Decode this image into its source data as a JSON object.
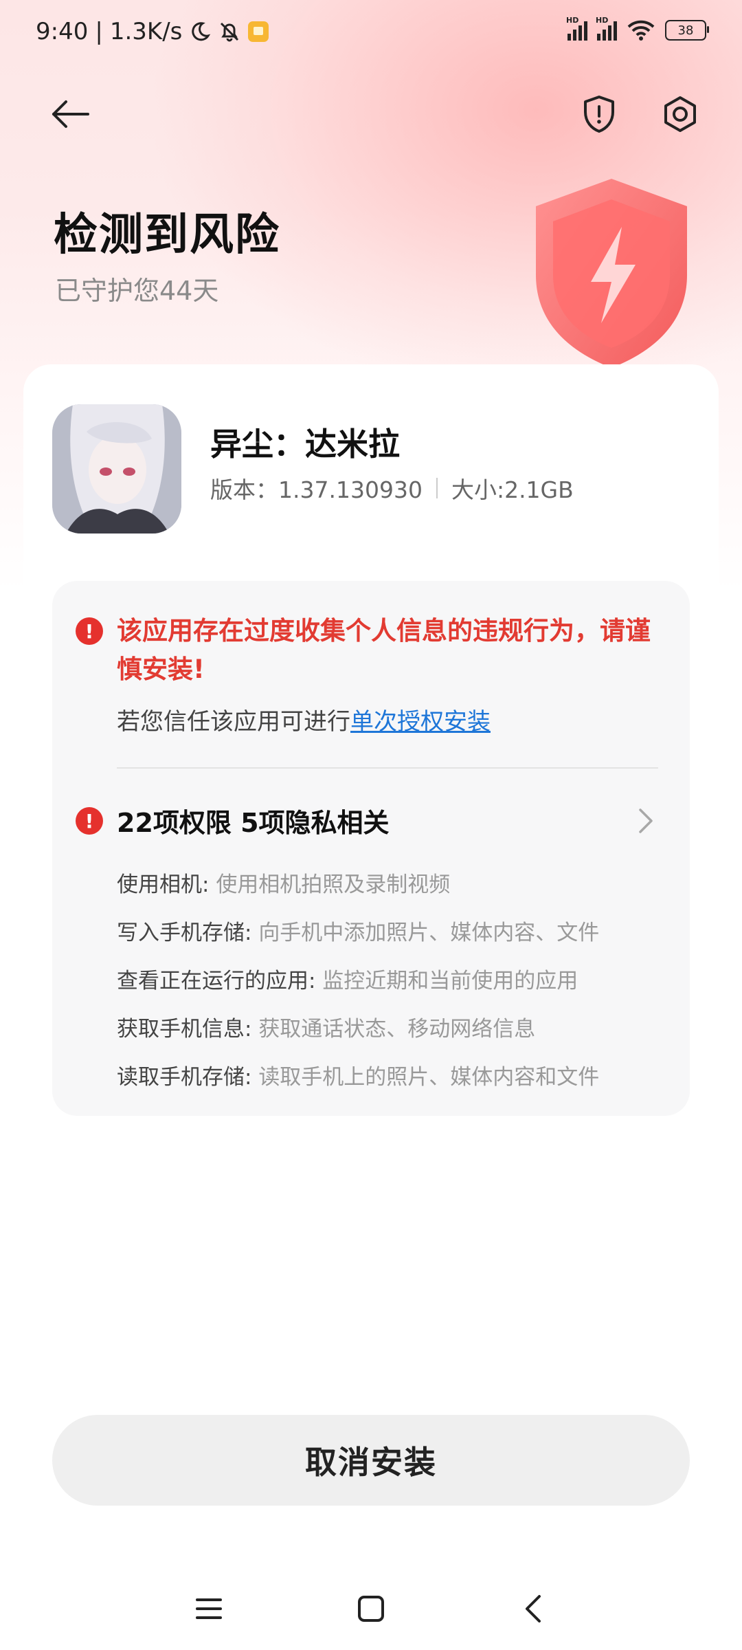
{
  "status_bar": {
    "time": "9:40",
    "net_speed": "1.3K/s",
    "signal_badge_1": "HD",
    "signal_badge_2": "HD",
    "battery": "38"
  },
  "header": {
    "back_icon": "back-arrow-icon",
    "shield_icon": "shield-alert-icon",
    "settings_icon": "settings-icon"
  },
  "hero": {
    "title": "检测到风险",
    "subtitle": "已守护您44天",
    "accent_color": "#ff6b6b"
  },
  "app": {
    "name": "异尘：达米拉",
    "version_label": "版本：1.37.130930",
    "size_label": "大小:2.1GB"
  },
  "warning": {
    "message": "该应用存在过度收集个人信息的违规行为，请谨慎安装!",
    "trust_prefix": "若您信任该应用可进行",
    "trust_link": "单次授权安装",
    "alert_color": "#e5312d",
    "link_color": "#1e76d8"
  },
  "permissions": {
    "summary": "22项权限 5项隐私相关",
    "items": [
      {
        "name": "使用相机:",
        "desc": "使用相机拍照及录制视频"
      },
      {
        "name": "写入手机存储:",
        "desc": "向手机中添加照片、媒体内容、文件"
      },
      {
        "name": "查看正在运行的应用:",
        "desc": "监控近期和当前使用的应用"
      },
      {
        "name": "获取手机信息:",
        "desc": "获取通话状态、移动网络信息"
      },
      {
        "name": "读取手机存储:",
        "desc": "读取手机上的照片、媒体内容和文件"
      }
    ]
  },
  "actions": {
    "cancel_label": "取消安装"
  },
  "navbar": {
    "menu_icon": "menu-icon",
    "home_icon": "home-icon",
    "back_icon": "nav-back-icon"
  }
}
